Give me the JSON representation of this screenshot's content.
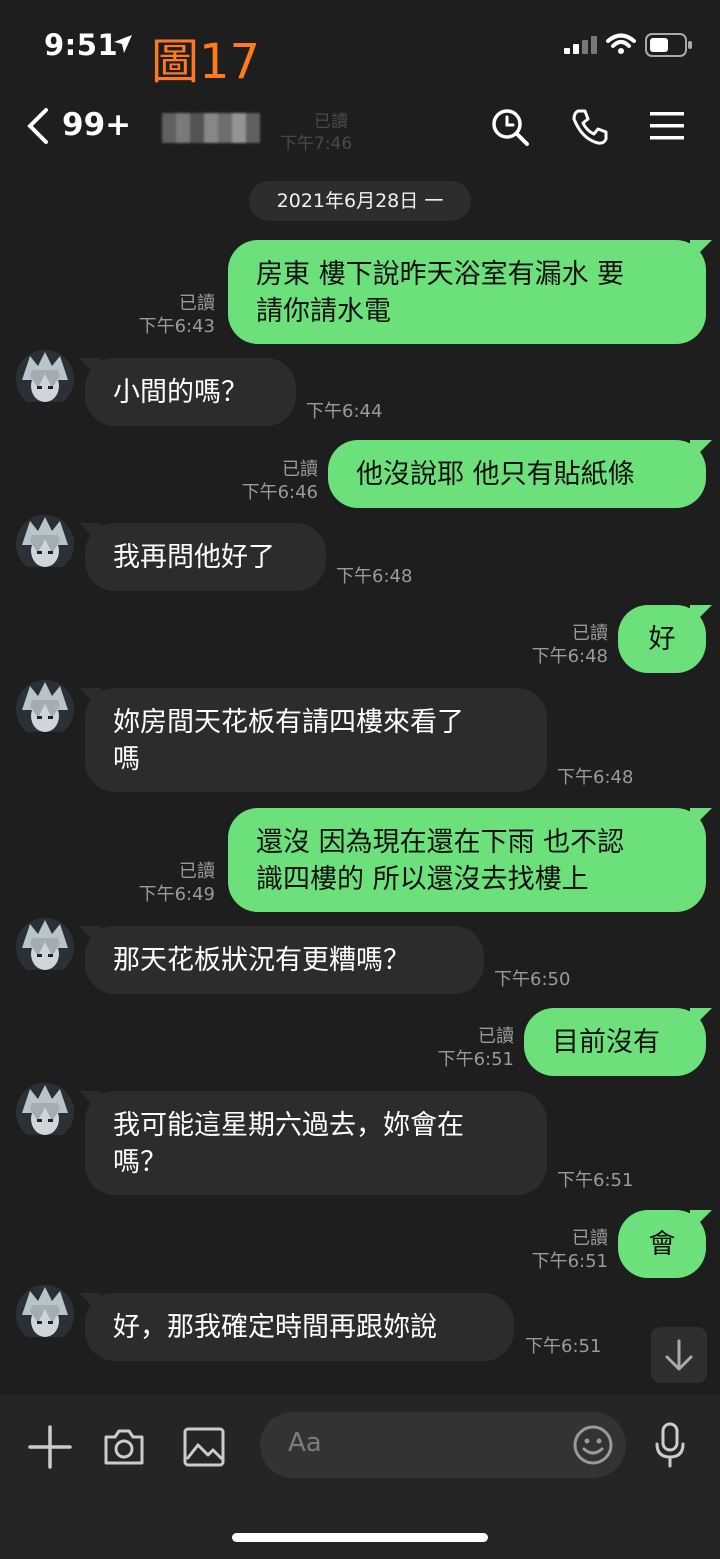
{
  "status_bar": {
    "time": "9:51",
    "figure_label": "圖17"
  },
  "header": {
    "unread_count": "99+",
    "ghost_read": "已讀",
    "ghost_time": "下午7:46"
  },
  "date_separator": "2021年6月28日 一",
  "messages": [
    {
      "side": "out",
      "text_lines": [
        "房東 樓下說昨天浴室有漏水 要",
        "請你請水電"
      ],
      "read": "已讀",
      "time": "下午6:43"
    },
    {
      "side": "in",
      "text_lines": [
        "小間的嗎？"
      ],
      "time": "下午6:44"
    },
    {
      "side": "out",
      "text_lines": [
        "他沒說耶 他只有貼紙條"
      ],
      "read": "已讀",
      "time": "下午6:46"
    },
    {
      "side": "in",
      "text_lines": [
        "我再問他好了"
      ],
      "time": "下午6:48"
    },
    {
      "side": "out",
      "text_lines": [
        "好"
      ],
      "read": "已讀",
      "time": "下午6:48"
    },
    {
      "side": "in",
      "text_lines": [
        "妳房間天花板有請四樓來看了",
        "嗎"
      ],
      "time": "下午6:48"
    },
    {
      "side": "out",
      "text_lines": [
        "還沒 因為現在還在下雨 也不認",
        "識四樓的 所以還沒去找樓上"
      ],
      "read": "已讀",
      "time": "下午6:49"
    },
    {
      "side": "in",
      "text_lines": [
        "那天花板狀況有更糟嗎？"
      ],
      "time": "下午6:50"
    },
    {
      "side": "out",
      "text_lines": [
        "目前沒有"
      ],
      "read": "已讀",
      "time": "下午6:51"
    },
    {
      "side": "in",
      "text_lines": [
        "我可能這星期六過去，妳會在",
        "嗎？"
      ],
      "time": "下午6:51"
    },
    {
      "side": "out",
      "text_lines": [
        "會"
      ],
      "read": "已讀",
      "time": "下午6:51"
    },
    {
      "side": "in",
      "text_lines": [
        "好，那我確定時間再跟妳說"
      ],
      "time": "下午6:51"
    }
  ],
  "input": {
    "placeholder": "Aa"
  },
  "colors": {
    "outgoing_bubble": "#6ce07a",
    "incoming_bubble": "#2c2c2c",
    "background": "#1e1e1e",
    "figure_label": "#ff7a1c"
  }
}
